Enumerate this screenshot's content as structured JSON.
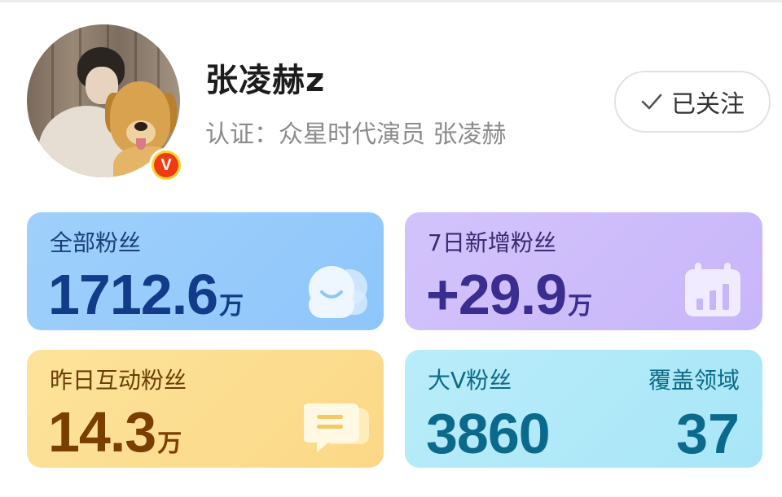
{
  "profile": {
    "name": "张凌赫z",
    "verification": "认证：众星时代演员 张凌赫",
    "badge_letter": "V",
    "follow_button": "已关注"
  },
  "stats": {
    "total_fans": {
      "label": "全部粉丝",
      "value": "1712.6",
      "unit": "万"
    },
    "new_fans_7d": {
      "label": "7日新增粉丝",
      "value": "+29.9",
      "unit": "万"
    },
    "active_fans_yesterday": {
      "label": "昨日互动粉丝",
      "value": "14.3",
      "unit": "万"
    },
    "bigv_fans": {
      "label": "大V粉丝",
      "value": "3860",
      "right_label": "覆盖领域",
      "right_value": "37"
    }
  },
  "colors": {
    "card_fans": "#8ec6fb",
    "card_new": "#c8b6fa",
    "card_active": "#fbd887",
    "card_bigv": "#a8e6f7",
    "badge_red": "#f03a14",
    "badge_yellow": "#f6d32a"
  },
  "icons": [
    "checkmark-icon",
    "fans-group-icon",
    "calendar-chart-icon",
    "chat-bubble-icon",
    "verified-v-icon"
  ]
}
